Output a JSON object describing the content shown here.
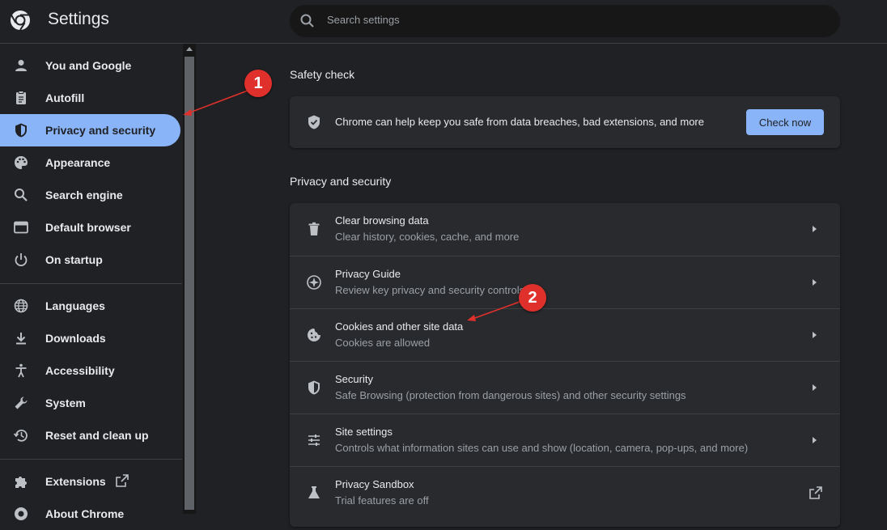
{
  "app": {
    "title": "Settings"
  },
  "search": {
    "placeholder": "Search settings"
  },
  "sidebar": {
    "items": [
      {
        "label": "You and Google",
        "icon": "person-icon"
      },
      {
        "label": "Autofill",
        "icon": "clipboard-icon"
      },
      {
        "label": "Privacy and security",
        "icon": "shield-icon",
        "active": true
      },
      {
        "label": "Appearance",
        "icon": "palette-icon"
      },
      {
        "label": "Search engine",
        "icon": "search-icon"
      },
      {
        "label": "Default browser",
        "icon": "browser-icon"
      },
      {
        "label": "On startup",
        "icon": "power-icon"
      },
      {
        "label": "Languages",
        "icon": "globe-icon"
      },
      {
        "label": "Downloads",
        "icon": "download-icon"
      },
      {
        "label": "Accessibility",
        "icon": "accessibility-icon"
      },
      {
        "label": "System",
        "icon": "wrench-icon"
      },
      {
        "label": "Reset and clean up",
        "icon": "history-icon"
      },
      {
        "label": "Extensions",
        "icon": "puzzle-icon"
      },
      {
        "label": "About Chrome",
        "icon": "chrome-icon"
      }
    ]
  },
  "safety_check": {
    "title": "Safety check",
    "text": "Chrome can help keep you safe from data breaches, bad extensions, and more",
    "button": "Check now"
  },
  "privacy": {
    "title": "Privacy and security",
    "rows": [
      {
        "title": "Clear browsing data",
        "subtitle": "Clear history, cookies, cache, and more",
        "icon": "trash-icon"
      },
      {
        "title": "Privacy Guide",
        "subtitle": "Review key privacy and security controls",
        "icon": "compass-icon"
      },
      {
        "title": "Cookies and other site data",
        "subtitle": "Cookies are allowed",
        "icon": "cookie-icon"
      },
      {
        "title": "Security",
        "subtitle": "Safe Browsing (protection from dangerous sites) and other security settings",
        "icon": "shield-icon"
      },
      {
        "title": "Site settings",
        "subtitle": "Controls what information sites can use and show (location, camera, pop-ups, and more)",
        "icon": "sliders-icon"
      },
      {
        "title": "Privacy Sandbox",
        "subtitle": "Trial features are off",
        "icon": "flask-icon"
      }
    ]
  },
  "annotations": {
    "badge1": "1",
    "badge2": "2"
  },
  "colors": {
    "accent": "#8ab4f8",
    "background": "#202124",
    "card": "#292a2d",
    "badge": "#e0302c"
  }
}
